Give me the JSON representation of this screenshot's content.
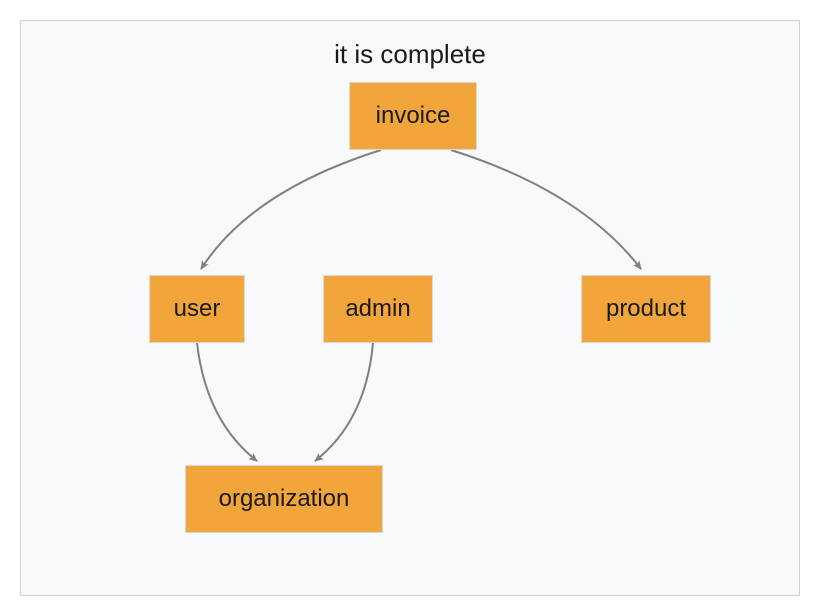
{
  "title": "it is complete",
  "nodes": {
    "invoice": {
      "label": "invoice"
    },
    "user": {
      "label": "user"
    },
    "admin": {
      "label": "admin"
    },
    "product": {
      "label": "product"
    },
    "organization": {
      "label": "organization"
    }
  },
  "edges": [
    {
      "from": "invoice",
      "to": "user"
    },
    {
      "from": "invoice",
      "to": "product"
    },
    {
      "from": "user",
      "to": "organization"
    },
    {
      "from": "admin",
      "to": "organization"
    }
  ],
  "style": {
    "node_fill": "#f1a53a",
    "node_border": "#d9d9d9",
    "edge_color": "#808080",
    "canvas_bg": "#f8f9fa",
    "canvas_border": "#d0d1d3"
  }
}
